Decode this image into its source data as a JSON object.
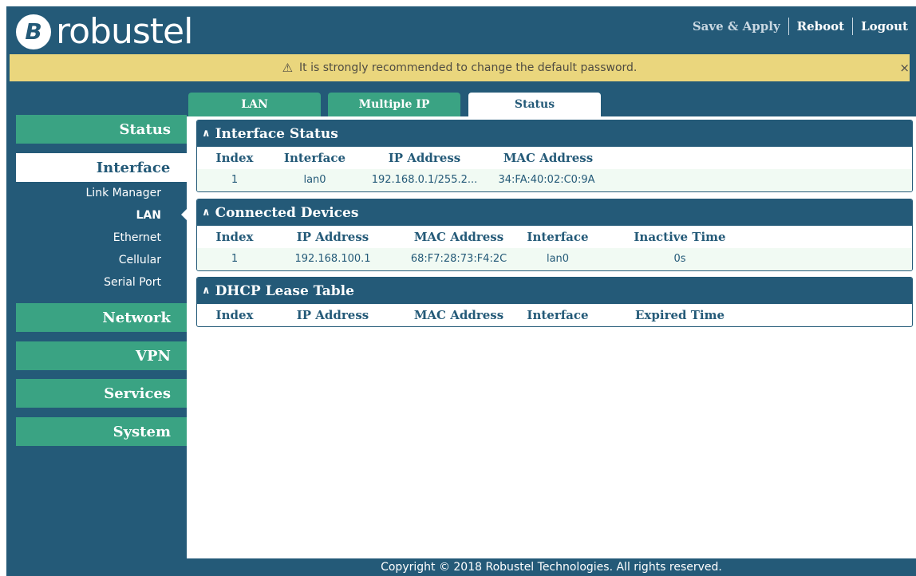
{
  "header": {
    "brand": "robustel",
    "brand_mark": "B",
    "links": {
      "save_apply": "Save & Apply",
      "reboot": "Reboot",
      "logout": "Logout"
    }
  },
  "warning": {
    "icon": "⚠",
    "text": "It is strongly recommended to change the default password.",
    "close": "×"
  },
  "sidebar": {
    "status": "Status",
    "interface": "Interface",
    "subitems": [
      "Link Manager",
      "LAN",
      "Ethernet",
      "Cellular",
      "Serial Port"
    ],
    "network": "Network",
    "vpn": "VPN",
    "services": "Services",
    "system": "System"
  },
  "tabs": [
    "LAN",
    "Multiple IP",
    "Status"
  ],
  "panels": {
    "interface_status": {
      "title": "Interface Status",
      "chevron": "^",
      "headers": [
        "Index",
        "Interface",
        "IP Address",
        "MAC Address"
      ],
      "rows": [
        [
          "1",
          "lan0",
          "192.168.0.1/255.2...",
          "34:FA:40:02:C0:9A"
        ]
      ]
    },
    "connected_devices": {
      "title": "Connected Devices",
      "chevron": "^",
      "headers": [
        "Index",
        "IP Address",
        "MAC Address",
        "Interface",
        "Inactive Time"
      ],
      "rows": [
        [
          "1",
          "192.168.100.1",
          "68:F7:28:73:F4:2C",
          "lan0",
          "0s"
        ]
      ]
    },
    "dhcp_lease": {
      "title": "DHCP Lease Table",
      "chevron": "^",
      "headers": [
        "Index",
        "IP Address",
        "MAC Address",
        "Interface",
        "Expired Time"
      ]
    }
  },
  "footer": "Copyright © 2018 Robustel Technologies. All rights reserved.",
  "colors": {
    "primary": "#245a78",
    "accent": "#3aa383",
    "warning": "#ead67d",
    "row_highlight": "#f1faf3"
  }
}
